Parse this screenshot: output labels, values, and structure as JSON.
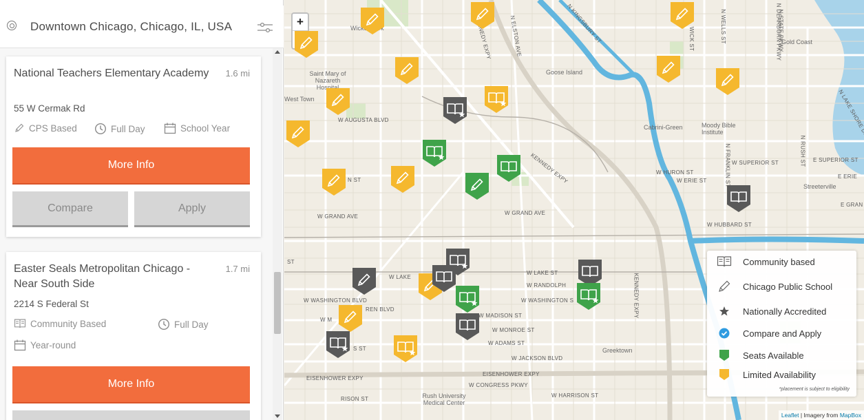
{
  "search": {
    "location_text": "Downtown Chicago, Chicago, IL, USA"
  },
  "results": [
    {
      "name": "National Teachers Elementary Academy",
      "distance": "1.6 mi",
      "address": "55 W Cermak Rd",
      "features": [
        "CPS Based",
        "Full Day",
        "School Year"
      ],
      "more_info_label": "More Info",
      "compare_label": "Compare",
      "apply_label": "Apply"
    },
    {
      "name": "Easter Seals Metropolitan Chicago - Near South Side",
      "distance": "1.7 mi",
      "address": "2214 S Federal St",
      "features": [
        "Community Based",
        "Full Day",
        "Year-round"
      ],
      "more_info_label": "More Info"
    }
  ],
  "map": {
    "zoom_in": "+",
    "zoom_out": "−",
    "colors": {
      "limited": "#f5b82e",
      "seats": "#3fa34a",
      "unavailable": "#595959",
      "water": "#a8d3ea",
      "river": "#62b6df",
      "more_info": "#f26d3d"
    },
    "streets": [
      "W AUGUSTA BLVD",
      "N ST",
      "W GRAND AVE",
      "W GRAND AVE",
      "W LAKE ST",
      "W RANDOLPH",
      "W WASHINGTON BLVD",
      "W WASHINGTON S",
      "REN BLVD",
      "W MADISON ST",
      "W MONROE ST",
      "W ADAMS ST",
      "W JACKSON BLVD",
      "EISENHOWER EXPY",
      "EISENHOWER EXPY",
      "W CONGRESS PKWY",
      "W HARRISON ST",
      "RISON ST",
      "S ST",
      "W M",
      "ST",
      "W LAKE",
      "KENNEDY EXPY",
      "KENNEDY EXPY",
      "W HURON ST",
      "W ERIE ST",
      "W SUPERIOR ST",
      "E SUPERIOR ST",
      "E ERIE",
      "E GRAN",
      "W HUBBARD ST",
      "N KINGSBURY ST",
      "N ELSTON AVE",
      "KENNEDY EXPY",
      "N STATE PKWY",
      "N LAKE SHORE DR",
      "N RUSH ST",
      "N FRANKLIN ST",
      "N WELLS ST",
      "WICK ST",
      "N DEARBORN PKWY"
    ],
    "places": [
      "Wicker Park",
      "Saint Mary of Nazareth Hospital",
      "West Town",
      "Goose Island",
      "Cabrini-Green",
      "Moody Bible Institute",
      "Gold Coast",
      "Streeterville",
      "Greektown",
      "Rush University Medical Center"
    ],
    "markers": [
      {
        "kind": "pencil",
        "status": "limited"
      },
      {
        "kind": "pencil",
        "status": "limited"
      },
      {
        "kind": "pencil",
        "status": "limited"
      },
      {
        "kind": "pencil",
        "status": "limited"
      },
      {
        "kind": "pencil",
        "status": "limited"
      },
      {
        "kind": "pencil",
        "status": "limited"
      },
      {
        "kind": "pencil",
        "status": "limited"
      },
      {
        "kind": "pencil",
        "status": "limited"
      },
      {
        "kind": "pencil",
        "status": "limited"
      },
      {
        "kind": "pencil",
        "status": "limited"
      },
      {
        "kind": "pencil",
        "status": "limited"
      },
      {
        "kind": "pencil",
        "status": "seats"
      },
      {
        "kind": "pencil",
        "status": "unavailable"
      },
      {
        "kind": "pencil",
        "status": "limited"
      },
      {
        "kind": "pencil",
        "status": "limited"
      },
      {
        "kind": "book",
        "status": "unavailable",
        "accredited": true
      },
      {
        "kind": "book",
        "status": "limited",
        "accredited": true
      },
      {
        "kind": "book",
        "status": "seats",
        "accredited": true
      },
      {
        "kind": "book",
        "status": "seats",
        "accredited": false
      },
      {
        "kind": "book",
        "status": "unavailable",
        "accredited": false
      },
      {
        "kind": "book",
        "status": "unavailable",
        "accredited": true
      },
      {
        "kind": "book",
        "status": "unavailable",
        "accredited": false
      },
      {
        "kind": "book",
        "status": "seats",
        "accredited": true
      },
      {
        "kind": "book",
        "status": "unavailable",
        "accredited": false
      },
      {
        "kind": "book",
        "status": "seats",
        "accredited": true
      },
      {
        "kind": "book",
        "status": "unavailable",
        "accredited": false
      },
      {
        "kind": "book",
        "status": "unavailable",
        "accredited": true
      },
      {
        "kind": "book",
        "status": "limited",
        "accredited": true
      }
    ]
  },
  "legend": {
    "items": [
      "Community based",
      "Chicago Public School",
      "Nationally Accredited",
      "Compare and Apply",
      "Seats Available",
      "Limited Availability"
    ],
    "note": "*placement is subject to eligibility"
  },
  "attribution": {
    "leaflet": "Leaflet",
    "text": " | Imagery from ",
    "provider": "MapBox"
  }
}
